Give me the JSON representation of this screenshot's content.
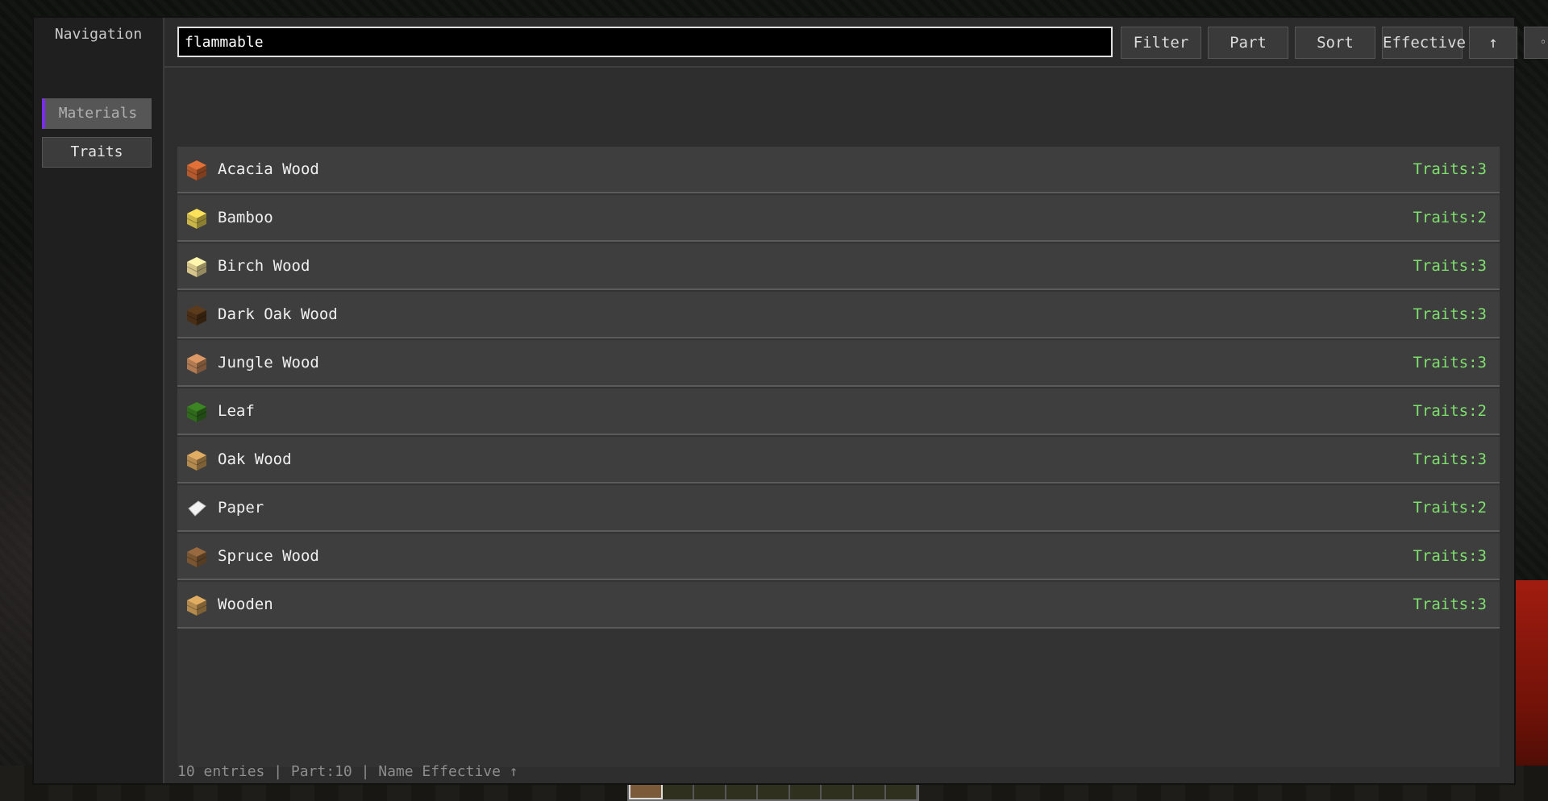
{
  "navigation": {
    "title": "Navigation",
    "items": [
      {
        "label": "Materials",
        "active": true
      },
      {
        "label": "Traits",
        "active": false
      }
    ],
    "active_accent": "#7b2cf0"
  },
  "toolbar": {
    "search_value": "flammable",
    "filter_label": "Filter",
    "part_label": "Part",
    "sort_label": "Sort",
    "effective_label": "Effective",
    "direction_label": "↑",
    "options_label": "◦"
  },
  "materials": [
    {
      "name": "Acacia Wood",
      "traits": "Traits:3",
      "icon": "acacia-wood-icon",
      "color": "#b55a2c"
    },
    {
      "name": "Bamboo",
      "traits": "Traits:2",
      "icon": "bamboo-icon",
      "color": "#c9b548"
    },
    {
      "name": "Birch Wood",
      "traits": "Traits:3",
      "icon": "birch-wood-icon",
      "color": "#d6c58a"
    },
    {
      "name": "Dark Oak Wood",
      "traits": "Traits:3",
      "icon": "dark-oak-wood-icon",
      "color": "#4a2e16"
    },
    {
      "name": "Jungle Wood",
      "traits": "Traits:3",
      "icon": "jungle-wood-icon",
      "color": "#b07a52"
    },
    {
      "name": "Leaf",
      "traits": "Traits:2",
      "icon": "leaf-icon",
      "color": "#2f6a1c"
    },
    {
      "name": "Oak Wood",
      "traits": "Traits:3",
      "icon": "oak-wood-icon",
      "color": "#b48a4e"
    },
    {
      "name": "Paper",
      "traits": "Traits:2",
      "icon": "paper-icon",
      "color": "#f2f2f2"
    },
    {
      "name": "Spruce Wood",
      "traits": "Traits:3",
      "icon": "spruce-wood-icon",
      "color": "#7a5532"
    },
    {
      "name": "Wooden",
      "traits": "Traits:3",
      "icon": "wooden-icon",
      "color": "#b48a4e"
    }
  ],
  "traits_color": "#7ee06d",
  "status_bar": "10 entries | Part:10 | Name Effective ↑"
}
